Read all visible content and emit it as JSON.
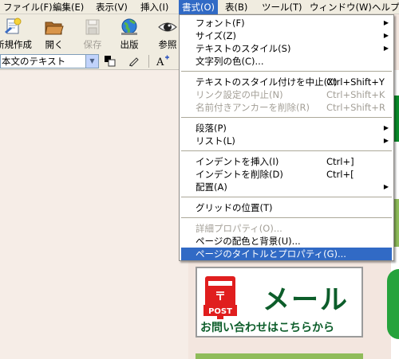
{
  "menubar": {
    "items": [
      {
        "label": "ファイル(F)"
      },
      {
        "label": "編集(E)"
      },
      {
        "label": "表示(V)"
      },
      {
        "label": "挿入(I)"
      },
      {
        "label": "書式(O)"
      },
      {
        "label": "表(B)"
      },
      {
        "label": "ツール(T)"
      },
      {
        "label": "ウィンドウ(W)"
      },
      {
        "label": "ヘルプ"
      }
    ]
  },
  "toolbar": {
    "new_label": "新規作成",
    "open_label": "開く",
    "save_label": "保存",
    "publish_label": "出版",
    "browse_label": "参照"
  },
  "formatbar": {
    "style_value": "本文のテキスト"
  },
  "format_menu": {
    "items": [
      {
        "label": "フォント(F)",
        "submenu": true
      },
      {
        "label": "サイズ(Z)",
        "submenu": true
      },
      {
        "label": "テキストのスタイル(S)",
        "submenu": true
      },
      {
        "label": "文字列の色(C)..."
      },
      {
        "label": "テキストのスタイル付けを中止(X)",
        "shortcut": "Ctrl+Shift+Y"
      },
      {
        "label": "リンク設定の中止(N)",
        "shortcut": "Ctrl+Shift+K",
        "disabled": true
      },
      {
        "label": "名前付きアンカーを削除(R)",
        "shortcut": "Ctrl+Shift+R",
        "disabled": true
      },
      {
        "label": "段落(P)",
        "submenu": true
      },
      {
        "label": "リスト(L)",
        "submenu": true
      },
      {
        "label": "インデントを挿入(I)",
        "shortcut": "Ctrl+]"
      },
      {
        "label": "インデントを削除(D)",
        "shortcut": "Ctrl+["
      },
      {
        "label": "配置(A)",
        "submenu": true
      },
      {
        "label": "グリッドの位置(T)"
      },
      {
        "label": "詳細プロパティ(O)...",
        "disabled": true
      },
      {
        "label": "ページの配色と背景(U)..."
      },
      {
        "label": "ページのタイトルとプロパティ(G)...",
        "highlighted": true
      }
    ],
    "submenu_arrow": "▶"
  },
  "banner": {
    "title": "メール",
    "subtitle": "お問い合わせはこちらから",
    "post_label": "POST"
  },
  "colors": {
    "menu_highlight": "#316ac5",
    "banner_green": "#0c5d2a",
    "mailbox_red": "#e01e1e"
  }
}
